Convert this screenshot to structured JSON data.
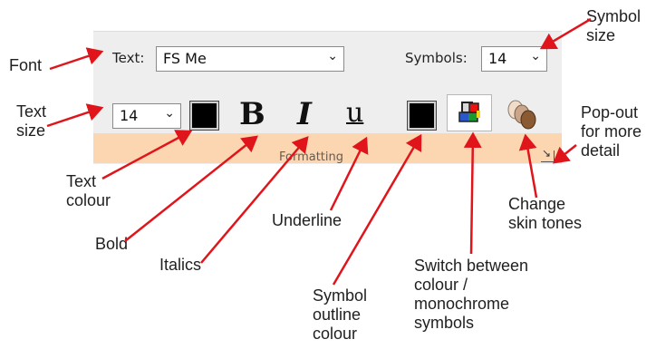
{
  "ribbon": {
    "text_label": "Text:",
    "font_value": "FS Me",
    "symbols_label": "Symbols:",
    "symbol_size_value": "14",
    "text_size_value": "14",
    "bold_label": "B",
    "italic_label": "I",
    "underline_label": "u",
    "group_label": "Formatting"
  },
  "annotations": {
    "font": "Font",
    "text_size": "Text\nsize",
    "symbol_size": "Symbol\nsize",
    "popout": "Pop-out\nfor more\ndetail",
    "text_colour": "Text\ncolour",
    "bold": "Bold",
    "italics": "Italics",
    "underline": "Underline",
    "symbol_outline_colour": "Symbol\noutline\ncolour",
    "switch_colour": "Switch between\ncolour /\nmonochrome\nsymbols",
    "skin_tones": "Change\nskin tones"
  },
  "colors": {
    "arrow": "#e0151b",
    "ribbon_bg": "#eeeeee",
    "footer_bg": "#fcd6b0"
  },
  "icons": {
    "dropdown": "chevron-down-icon",
    "colour_switch": "colour-symbols-icon",
    "skin_tones": "skin-tones-icon",
    "launcher": "dialog-launcher-icon"
  }
}
